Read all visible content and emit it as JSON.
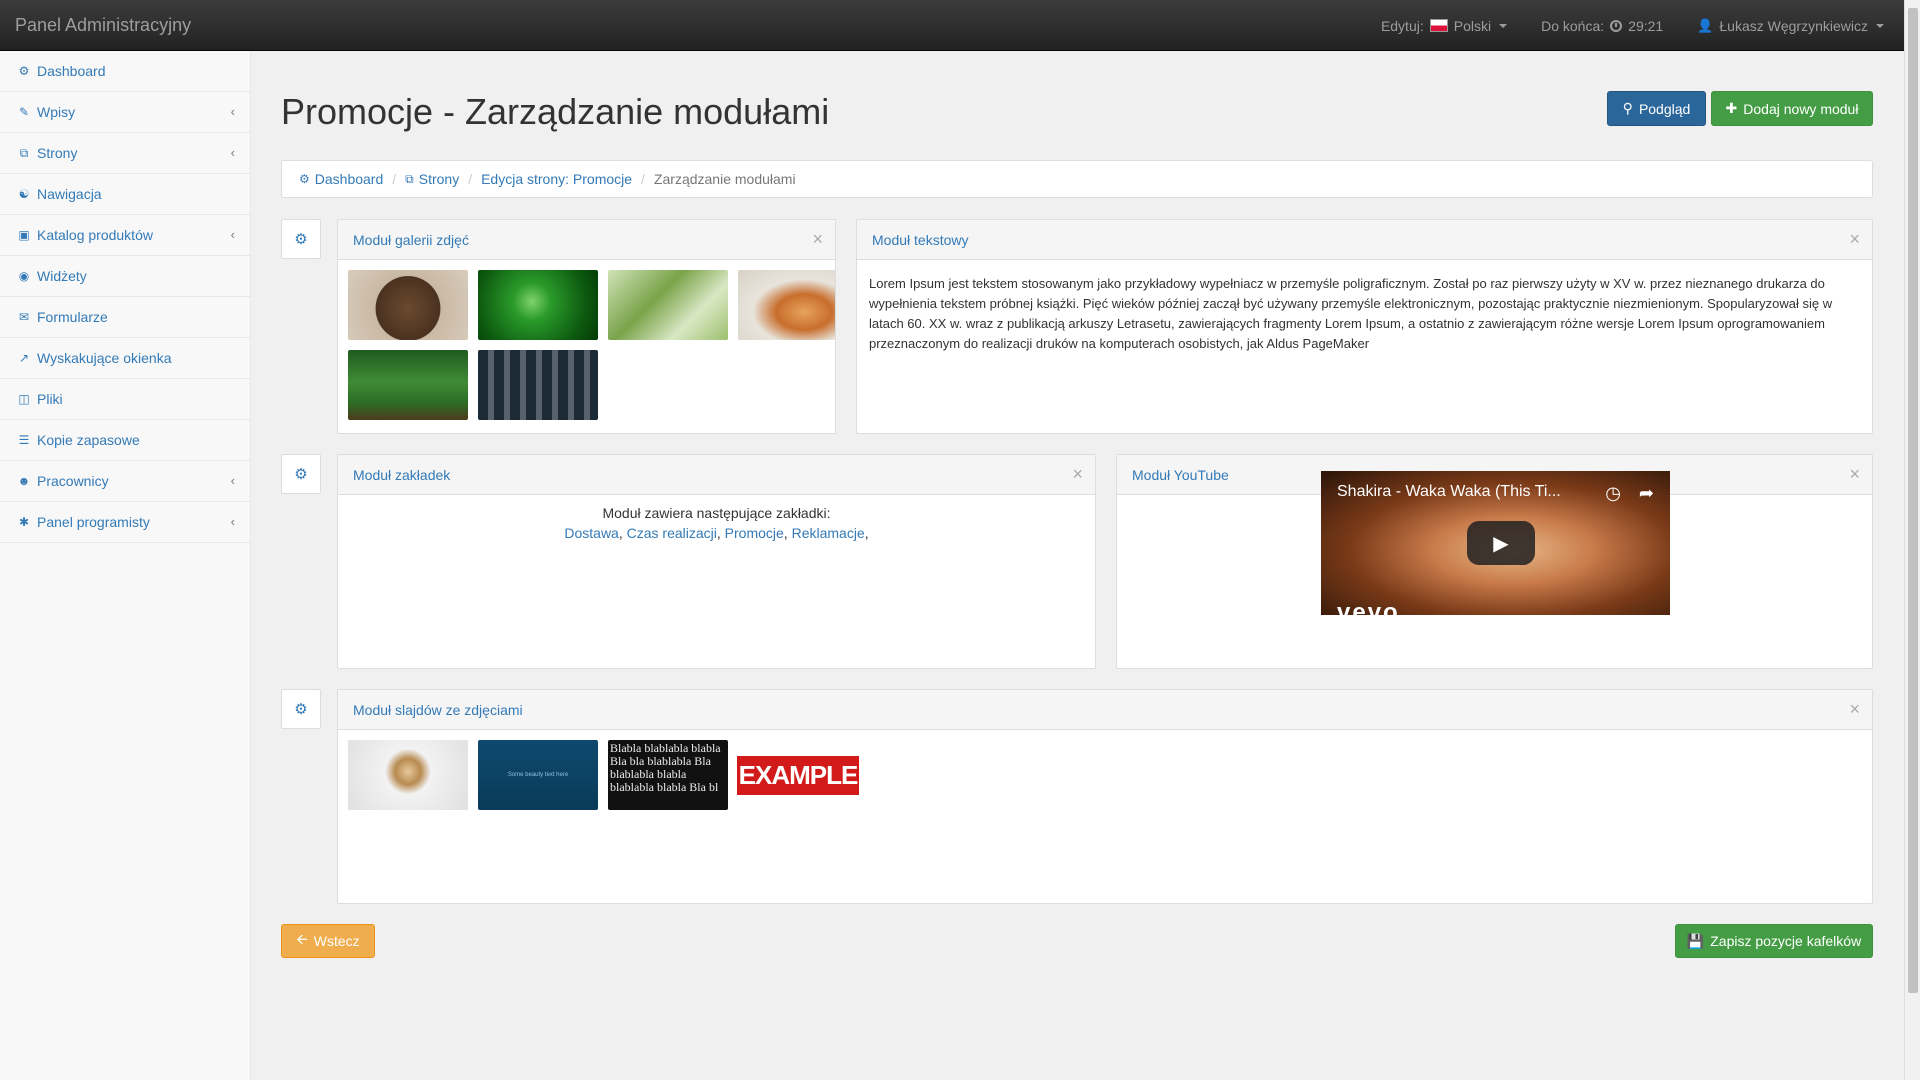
{
  "navbar": {
    "brand": "Panel Administracyjny",
    "edit_label": "Edytuj:",
    "language": "Polski",
    "countdown_label": "Do końca:",
    "countdown_value": "29:21",
    "user": "Łukasz Węgrzynkiewicz"
  },
  "sidebar": {
    "items": [
      {
        "label": "Dashboard",
        "icon": "dashboard-icon",
        "has_submenu": false
      },
      {
        "label": "Wpisy",
        "icon": "edit-icon",
        "has_submenu": true
      },
      {
        "label": "Strony",
        "icon": "copy-icon",
        "has_submenu": true
      },
      {
        "label": "Nawigacja",
        "icon": "sitemap-icon",
        "has_submenu": false
      },
      {
        "label": "Katalog produktów",
        "icon": "basket-icon",
        "has_submenu": true
      },
      {
        "label": "Widżety",
        "icon": "cube-icon",
        "has_submenu": false
      },
      {
        "label": "Formularze",
        "icon": "envelope-icon",
        "has_submenu": false
      },
      {
        "label": "Wyskakujące okienka",
        "icon": "external-link-icon",
        "has_submenu": false
      },
      {
        "label": "Pliki",
        "icon": "folder-icon",
        "has_submenu": false
      },
      {
        "label": "Kopie zapasowe",
        "icon": "database-icon",
        "has_submenu": false
      },
      {
        "label": "Pracownicy",
        "icon": "users-icon",
        "has_submenu": true
      },
      {
        "label": "Panel programisty",
        "icon": "bug-icon",
        "has_submenu": true
      }
    ]
  },
  "page": {
    "title": "Promocje - Zarządzanie modułami",
    "preview_button": "Podgląd",
    "add_button": "Dodaj nowy moduł",
    "back_button": "Wstecz",
    "save_button": "Zapisz pozycje kafelków"
  },
  "breadcrumb": [
    {
      "label": "Dashboard"
    },
    {
      "label": "Strony"
    },
    {
      "label": "Edycja strony: Promocje"
    },
    {
      "label": "Zarządzanie modułami"
    }
  ],
  "modules": {
    "gallery": {
      "title": "Moduł galerii zdjęć"
    },
    "text": {
      "title": "Moduł tekstowy",
      "body": "Lorem Ipsum jest tekstem stosowanym jako przykładowy wypełniacz w przemyśle poligraficznym. Został po raz pierwszy użyty w XV w. przez nieznanego drukarza do wypełnienia tekstem próbnej książki. Pięć wieków później zaczął być używany przemyśle elektronicznym, pozostając praktycznie niezmienionym. Spopularyzował się w latach 60. XX w. wraz z publikacją arkuszy Letrasetu, zawierających fragmenty Lorem Ipsum, a ostatnio z zawierającym różne wersje Lorem Ipsum oprogramowaniem przeznaczonym do realizacji druków na komputerach osobistych, jak Aldus PageMaker"
    },
    "tabs": {
      "title": "Moduł zakładek",
      "intro": "Moduł zawiera następujące zakładki:",
      "items": [
        "Dostawa",
        "Czas realizacji",
        "Promocje",
        "Reklamacje"
      ]
    },
    "youtube": {
      "title": "Moduł YouTube",
      "video_title": "Shakira - Waka Waka (This Ti...",
      "watermark": "vevo"
    },
    "slides": {
      "title": "Moduł slajdów ze zdjęciami",
      "slide2_text": "Some beauty text here",
      "slide3_text": "Blabla blablabla blabla Bla bla blablabla Bla blablabla blabla blablabla blabla Bla bl",
      "slide4_text": "EXAMPLE"
    }
  },
  "colors": {
    "link": "#337ab7",
    "primary": "#2b669a",
    "success": "#449d44",
    "warning": "#f0ad4e",
    "navbar": "#222222"
  }
}
